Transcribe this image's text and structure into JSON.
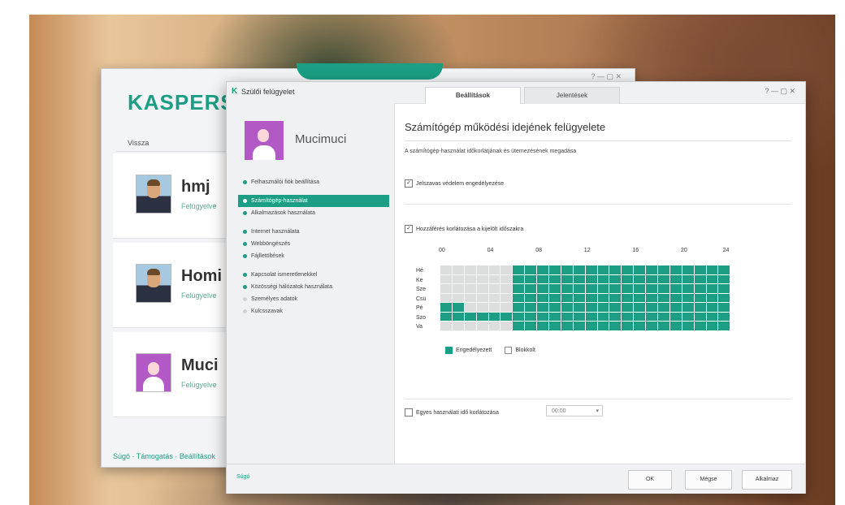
{
  "colors": {
    "accent": "#1b9e83",
    "allowed": "#1b9e83",
    "blocked": "#dcdddd"
  },
  "back_window": {
    "brand": "KASPERSKY",
    "breadcrumb": "Vissza",
    "users": [
      {
        "name": "hmj",
        "status": "Felügyelve",
        "avatar": "male-avatar"
      },
      {
        "name": "Homi",
        "status": "Felügyelve",
        "avatar": "male-avatar"
      },
      {
        "name": "Muci",
        "status": "Felügyelve",
        "avatar": "female-avatar"
      }
    ],
    "footer": "Súgó · Támogatás · Beállítások"
  },
  "window": {
    "title": "Szülői felügyelet",
    "tabs": [
      "Beállítások",
      "Jelentések"
    ],
    "controls": "? — ▢ ✕"
  },
  "sidebar": {
    "profile_name": "Mucimuci",
    "items": [
      "Felhasználói fiók beállítása",
      "Számítógép-használat",
      "Alkalmazások használata",
      "Internet használata",
      "Webböngészés",
      "Fájlletöltések",
      "Kapcsolat ismeretlenekkel",
      "Közösségi hálózatok használata",
      "Személyes adatok",
      "Kulcsszavak"
    ]
  },
  "main": {
    "title": "Számítógép működési idejének felügyelete",
    "description": "A számítógép-használat időkorlátjának és ütemezésének megadása",
    "protect_label": "Jelszavas védelem engedélyezése",
    "limit_label": "Hozzáférés korlátozása a kijelölt időszakra",
    "hours": [
      "00",
      "04",
      "08",
      "12",
      "16",
      "20",
      "24"
    ],
    "days": [
      "Hé",
      "Ke",
      "Sze",
      "Csü",
      "Pé",
      "Szo",
      "Va"
    ],
    "legend": {
      "allowed": "Engedélyezett",
      "blocked": "Blokkolt"
    },
    "break_label": "Egyes használati idő korlátozása",
    "break_value": "00:00"
  },
  "schedule": {
    "hours_per_day": 24,
    "allowed_from_hour": [
      6,
      6,
      6,
      6,
      0,
      0,
      6
    ],
    "blocked_ranges": [
      [
        0,
        6
      ],
      [
        0,
        6
      ],
      [
        0,
        6
      ],
      [
        0,
        6
      ],
      [
        2,
        6
      ],
      [],
      [
        0,
        6
      ]
    ]
  },
  "footer": {
    "help": "Súgó",
    "ok": "OK",
    "apply": "Mégse",
    "cancel": "Alkalmaz"
  }
}
